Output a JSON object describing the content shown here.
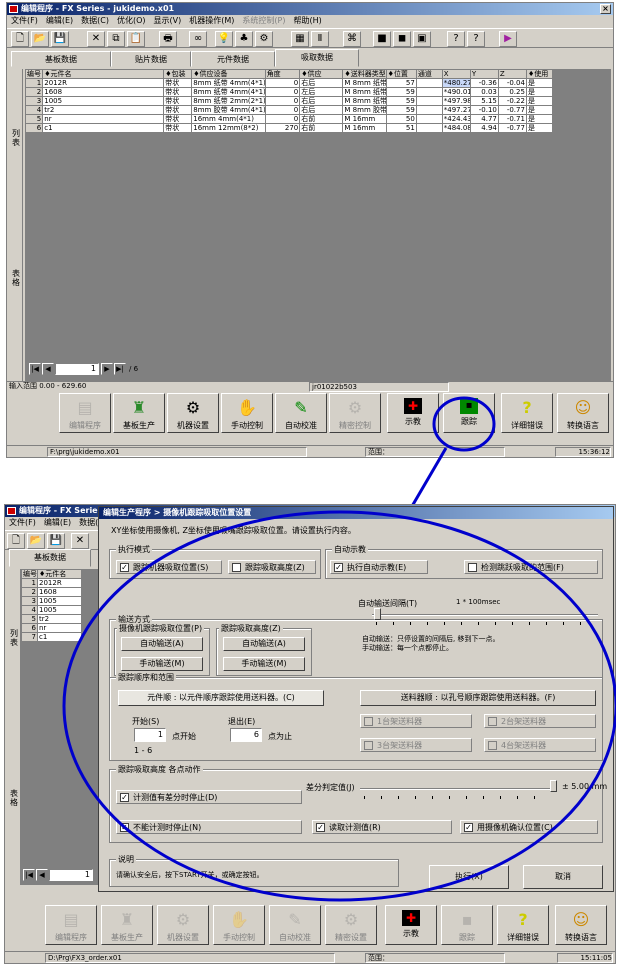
{
  "top": {
    "title": "编辑程序 - FX Series - jukidemo.x01",
    "menu": [
      "文件(F)",
      "编辑(E)",
      "数据(C)",
      "优化(O)",
      "显示(V)",
      "机器操作(M)",
      "系统控制(P)",
      "帮助(H)"
    ],
    "tabs": [
      "基板数据",
      "贴片数据",
      "元件数据",
      "吸取数据"
    ],
    "side_labels": [
      "列表",
      "表格"
    ],
    "headers": [
      "编号",
      "♦元件名",
      "♦包装",
      "♦供应设备",
      "角度",
      "♦供应",
      "♦送料器类型",
      "♦位置",
      "通道",
      "X",
      "Y",
      "Z",
      "♦使用"
    ],
    "rows": [
      [
        "1",
        "2012R",
        "带状",
        "8mm 纸带 4mm(4*1)",
        "0",
        "右后",
        "M 8mm 纸带",
        "57",
        "",
        "*480.27",
        "-0.36",
        "-0.04",
        "是"
      ],
      [
        "2",
        "1608",
        "带状",
        "8mm 纸带 4mm(4*1)",
        "0",
        "左后",
        "M 8mm 纸带",
        "59",
        "",
        "*490.01",
        "0.03",
        "0.25",
        "是"
      ],
      [
        "3",
        "1005",
        "带状",
        "8mm 纸带 2mm(2*1)",
        "0",
        "右后",
        "M 8mm 纸带",
        "59",
        "",
        "*497.98",
        "5.15",
        "-0.22",
        "是"
      ],
      [
        "4",
        "tr2",
        "带状",
        "8mm 胶带 4mm(4*1)",
        "0",
        "右后",
        "M 8mm 胶带",
        "59",
        "",
        "*497.27",
        "-0.10",
        "-0.77",
        "是"
      ],
      [
        "5",
        "nr",
        "带状",
        "16mm 4mm(4*1)",
        "0",
        "右前",
        "M 16mm",
        "50",
        "",
        "*424.43",
        "4.77",
        "-0.71",
        "是"
      ],
      [
        "6",
        "c1",
        "带状",
        "16mm 12mm(8*2)",
        "270",
        "右前",
        "M 16mm",
        "51",
        "",
        "*484.08",
        "4.94",
        "-0.77",
        "是"
      ]
    ],
    "pager": {
      "value": "1",
      "total": "/ 6"
    },
    "status": {
      "range": "输入范围 0.00 - 629.60",
      "field": "jr01022b503"
    },
    "buttons": [
      "编辑程序",
      "基板生产",
      "机器设置",
      "手动控制",
      "自动校准",
      "精密控制",
      "示教",
      "跟踪",
      "详细错误",
      "转换语言"
    ],
    "footer": {
      "path": "F:\\prg\\jukidemo.x01",
      "range_label": "范围：",
      "time": "15:36:12"
    }
  },
  "bottom": {
    "title": "编辑程序 - FX Series - F:\\",
    "menu": [
      "文件(F)",
      "编辑(E)",
      "数据(C)"
    ],
    "tab": "基板数据",
    "side_labels": [
      "列表",
      "表格"
    ],
    "headers": [
      "编号",
      "♦元件名"
    ],
    "rows": [
      [
        "1",
        "2012R"
      ],
      [
        "2",
        "1608"
      ],
      [
        "3",
        "1005"
      ],
      [
        "4",
        "1005"
      ],
      [
        "5",
        "tr2"
      ],
      [
        "6",
        "nr"
      ],
      [
        "7",
        "c1"
      ]
    ],
    "pager": {
      "value": "1"
    },
    "buttons": [
      "编辑程序",
      "基板生产",
      "机器设置",
      "手动控制",
      "自动校准",
      "精密设置",
      "示教",
      "跟踪",
      "详细错误",
      "转换语言"
    ],
    "footer": {
      "path": "D:\\Prg\\FX3_order.x01",
      "range_label": "范围：",
      "time": "15:11:05"
    }
  },
  "dialog": {
    "title": "编辑生产程序 > 摄像机跟踪吸取位置设置",
    "hint": "XY坐标使用摄像机, Z坐标使用吸嘴跟踪吸取位置。请设置执行内容。",
    "exec_mode": {
      "label": "执行模式",
      "opt1": "跟踪机器吸取位置(S)",
      "opt2": "跟踪吸取高度(Z)"
    },
    "auto_teach": {
      "label": "自动示教",
      "opt1": "执行自动示教(E)",
      "opt2": "检测跳跃吸取的范围(F)"
    },
    "transport": {
      "label": "输送方式",
      "left_label": "摄像机跟踪吸取位置(P)",
      "right_label": "跟踪吸取高度(Z)",
      "auto": "自动输送(A)",
      "manual": "手动输送(M)",
      "interval_label": "自动输送间隔(T)",
      "interval_unit": "1 * 100msec",
      "note1": "自动输送：只停设置的间隔后, 移到下一点。",
      "note2": "手动输送：每一个点都停止。"
    },
    "order": {
      "label": "跟踪顺序和范围",
      "by_part": "元件顺 : 以元件顺序跟踪使用送料器。(C)",
      "by_feeder": "送料器顺 : 以孔号顺序跟踪使用送料器。(F)",
      "start_label": "开始(S)",
      "start_value": "1",
      "start_suffix": "点开始",
      "end_label": "退出(E)",
      "end_value": "6",
      "end_suffix": "点为止",
      "range": "1 - 6",
      "f1": "1台架送料器",
      "f2": "2台架送料器",
      "f3": "3台架送料器",
      "f4": "4台架送料器"
    },
    "height": {
      "label": "跟踪吸取高度  各点动作",
      "stop_diff": "计测值有差分时停止(D)",
      "diff_label": "差分判定值(J)",
      "diff_value": "± 5.00 mm",
      "no_stop": "不能计测时停止(N)",
      "read": "读取计测值(R)",
      "confirm": "用摄像机确认位置(C)"
    },
    "desc": {
      "label": "说明",
      "text": "请确认安全后，按下START开关，或确定按钮。"
    },
    "execute": "执行(X)",
    "cancel": "取消"
  },
  "colors": {
    "title_start": "#0a246a",
    "title_end": "#a6caf0",
    "highlight": "#0000cc",
    "select": "#c8d8f8"
  }
}
